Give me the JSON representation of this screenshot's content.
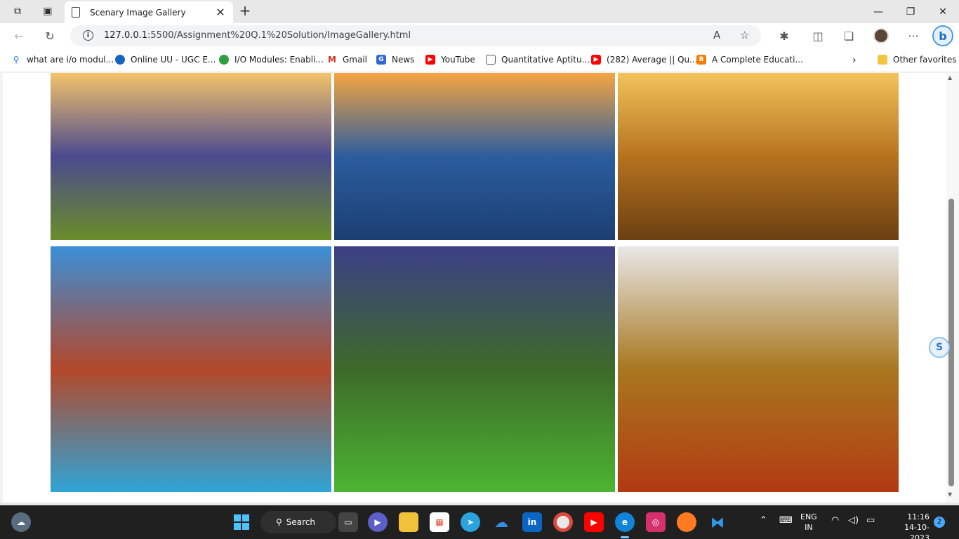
{
  "browser": {
    "tab_title": "Scenary Image Gallery",
    "url_host": "127.0.0.1",
    "url_rest": ":5500/Assignment%20Q.1%20Solution/ImageGallery.html"
  },
  "favorites": [
    {
      "label": "what are i/o modul...",
      "icon": "search-icon",
      "color": "#1a73e8"
    },
    {
      "label": "Online UU - UGC E...",
      "icon": "uu-logo-icon",
      "color": "#1565c0"
    },
    {
      "label": "I/O Modules: Enabli...",
      "icon": "leaf-icon",
      "color": "#2e9e3e"
    },
    {
      "label": "Gmail",
      "icon": "gmail-icon",
      "color": "#d93025"
    },
    {
      "label": "News",
      "icon": "news-icon",
      "color": "#3367d6"
    },
    {
      "label": "YouTube",
      "icon": "youtube-icon",
      "color": "#ff0000"
    },
    {
      "label": "Quantitative Aptitu...",
      "icon": "document-icon",
      "color": "#555555"
    },
    {
      "label": "(282) Average || Qu...",
      "icon": "youtube-icon",
      "color": "#ff0000"
    },
    {
      "label": "A Complete Educati...",
      "icon": "blogger-icon",
      "color": "#f57c00"
    }
  ],
  "other_favorites": "Other favorites",
  "gallery": [
    {
      "name": "sunset-mountain-meadow-image",
      "sky": "#f4c36a",
      "mid": "#4b4a8e",
      "ground": "#6a8d2a"
    },
    {
      "name": "frosty-rocks-lake-image",
      "sky": "#f6a540",
      "mid": "#2b5d9e",
      "ground": "#1c3f72"
    },
    {
      "name": "autumn-canal-reflection-image",
      "sky": "#f2c35b",
      "mid": "#b6731e",
      "ground": "#6b3f12"
    },
    {
      "name": "mountain-lake-reflection-image",
      "sky": "#3a8fd8",
      "mid": "#b4482a",
      "ground": "#2fa4d6"
    },
    {
      "name": "green-valley-sunset-image",
      "sky": "#3c3f86",
      "mid": "#3d6a2a",
      "ground": "#4cb530"
    },
    {
      "name": "autumn-lakeside-tree-image",
      "sky": "#e8e8e8",
      "mid": "#a8771f",
      "ground": "#b23a12"
    }
  ],
  "taskbar": {
    "search_label": "Search",
    "lang_line1": "ENG",
    "lang_line2": "IN",
    "time": "11:16",
    "date": "14-10-2023",
    "notifications": "2"
  }
}
